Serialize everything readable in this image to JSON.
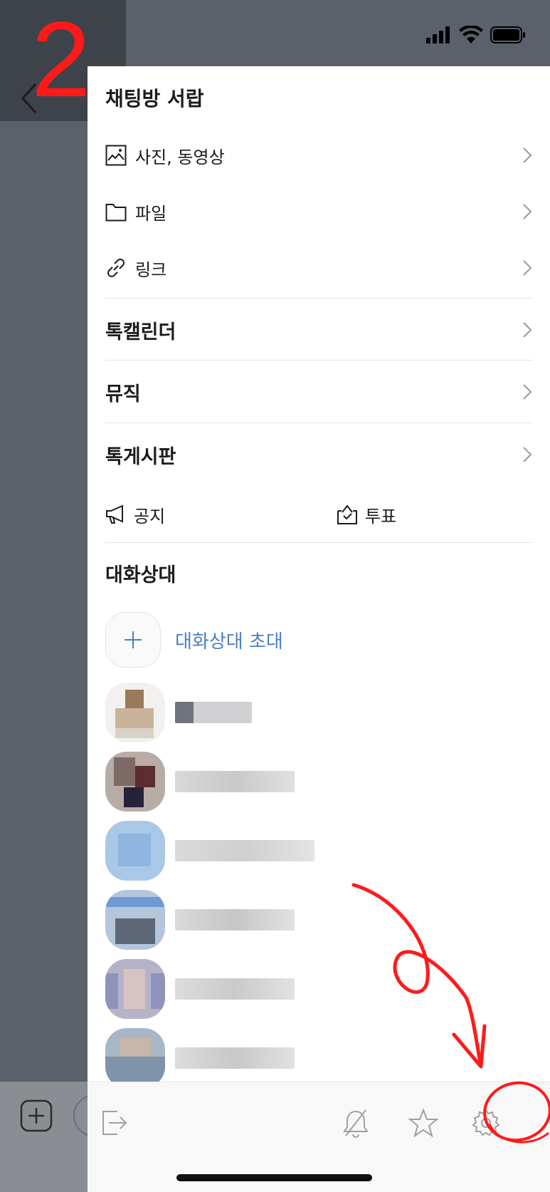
{
  "overlay": {
    "step_number": "2"
  },
  "drawer": {
    "title": "채팅방 서랍",
    "media_items": [
      {
        "icon": "photo-icon",
        "label": "사진, 동영상"
      },
      {
        "icon": "folder-icon",
        "label": "파일"
      },
      {
        "icon": "link-icon",
        "label": "링크"
      }
    ],
    "sections": [
      {
        "label": "톡캘린더"
      },
      {
        "label": "뮤직"
      },
      {
        "label": "톡게시판"
      }
    ],
    "notice_label": "공지",
    "vote_label": "투표",
    "members_title": "대화상대",
    "invite_label": "대화상대 초대"
  },
  "toolbar": {
    "icons": [
      "exit-icon",
      "notification-off-icon",
      "favorite-star-icon",
      "settings-gear-icon"
    ]
  },
  "colors": {
    "accent_blue": "#4a7fc4",
    "annotation_red": "#ff1a1a",
    "dim_background": "#5b616b"
  }
}
